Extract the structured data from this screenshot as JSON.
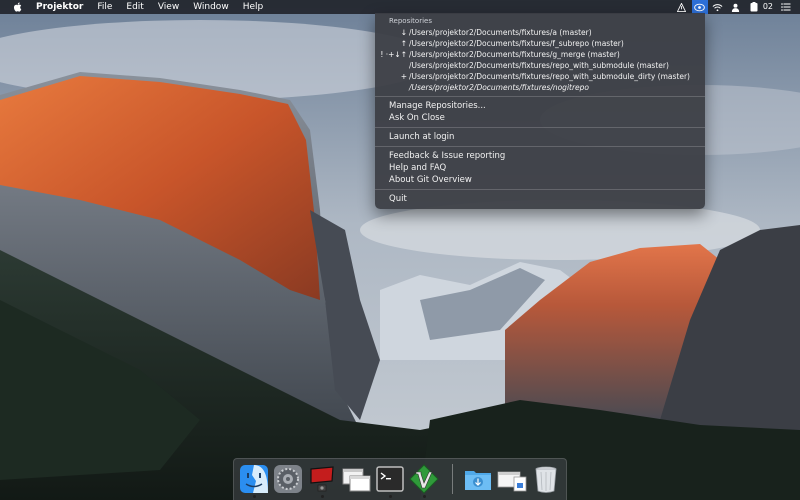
{
  "menubar": {
    "app_name": "Projektor",
    "menus": [
      "File",
      "Edit",
      "View",
      "Window",
      "Help"
    ],
    "battery_text": "02"
  },
  "dropdown": {
    "section_header": "Repositories",
    "repos": [
      {
        "status": "↓",
        "path": "/Users/projektor2/Documents/fixtures/a (master)",
        "italic": false
      },
      {
        "status": "↑",
        "path": "/Users/projektor2/Documents/fixtures/f_subrepo (master)",
        "italic": false
      },
      {
        "status": "! ·+↓↑",
        "path": "/Users/projektor2/Documents/fixtures/g_merge (master)",
        "italic": false
      },
      {
        "status": "",
        "path": "/Users/projektor2/Documents/fixtures/repo_with_submodule (master)",
        "italic": false
      },
      {
        "status": "+",
        "path": "/Users/projektor2/Documents/fixtures/repo_with_submodule_dirty (master)",
        "italic": false
      },
      {
        "status": "",
        "path": "/Users/projektor2/Documents/fixtures/nogitrepo",
        "italic": true
      }
    ],
    "manage_label": "Manage Repositories...",
    "ask_label": "Ask On Close",
    "launch_label": "Launch at login",
    "feedback_label": "Feedback & Issue reporting",
    "help_label": "Help and FAQ",
    "about_label": "About Git Overview",
    "quit_label": "Quit"
  },
  "dock": {
    "apps": [
      "finder-icon",
      "system-preferences-icon",
      "projektor-icon",
      "window-icon",
      "terminal-icon",
      "vim-icon",
      "downloads-folder-icon",
      "file-stack-icon",
      "trash-icon"
    ]
  },
  "colors": {
    "menu_highlight": "#2d6fd6",
    "menu_background": "#3c3e44"
  }
}
